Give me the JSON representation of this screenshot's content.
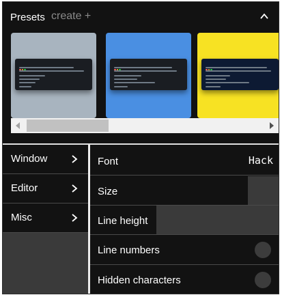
{
  "presets": {
    "title": "Presets",
    "create_label": "create +",
    "collapse_icon": "chevron-up-icon",
    "items": [
      {
        "name": "preset-1",
        "background": "#a8b4bf"
      },
      {
        "name": "preset-2",
        "background": "#4a8fe2"
      },
      {
        "name": "preset-3",
        "background": "#f7e223"
      }
    ]
  },
  "sidebar": {
    "items": [
      {
        "label": "Window",
        "icon": "chevron-right-icon"
      },
      {
        "label": "Editor",
        "icon": "chevron-right-icon"
      },
      {
        "label": "Misc",
        "icon": "chevron-right-icon"
      }
    ]
  },
  "settings": {
    "font": {
      "label": "Font",
      "value": "Hack"
    },
    "size": {
      "label": "Size",
      "fill_fraction": 0.83
    },
    "line_height": {
      "label": "Line height",
      "fill_fraction": 0.35
    },
    "line_numbers": {
      "label": "Line numbers",
      "enabled": false
    },
    "hidden_characters": {
      "label": "Hidden characters",
      "enabled": false
    }
  },
  "colors": {
    "panel_bg": "#121212",
    "track_bg": "#3a3a3a",
    "separator": "#e0e0e0"
  }
}
